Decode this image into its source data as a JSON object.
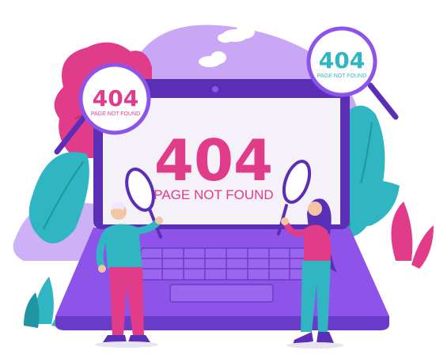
{
  "screen": {
    "code": "404",
    "message": "PAGE NOT FOUND"
  },
  "badge_left": {
    "code": "404",
    "message": "PAGE NOT FOUND"
  },
  "badge_right": {
    "code": "404",
    "message": "PAGE NOT FOUND"
  },
  "colors": {
    "primary_pink": "#e03c8a",
    "teal": "#2fb6c2",
    "purple": "#8e54e9",
    "lavender": "#c9a7f5",
    "laptop_dark": "#5b2fb5",
    "background": "#ffffff"
  },
  "icons": [
    "magnifier-icon",
    "laptop-illustration",
    "cloud-icon",
    "leaf-icon"
  ]
}
